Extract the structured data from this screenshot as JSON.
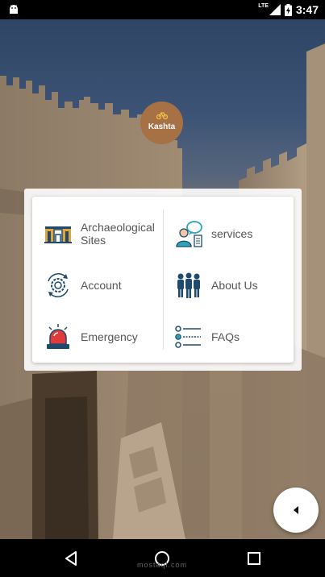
{
  "status_bar": {
    "network": "LTE",
    "time": "3:47",
    "icons": [
      "android-icon",
      "signal-icon",
      "battery-charging-icon"
    ]
  },
  "logo": {
    "text": "Kashta",
    "icon": "bicycle-icon"
  },
  "menu": {
    "items": [
      {
        "label": "Archaeological Sites",
        "icon": "archaeological-sites-icon"
      },
      {
        "label": "services",
        "icon": "customer-service-icon"
      },
      {
        "label": "Account",
        "icon": "account-gear-icon"
      },
      {
        "label": "About Us",
        "icon": "team-people-icon"
      },
      {
        "label": "Emergency",
        "icon": "siren-icon"
      },
      {
        "label": "FAQs",
        "icon": "faq-list-icon"
      }
    ]
  },
  "fab": {
    "icon": "back-arrow-icon"
  },
  "nav_bar": {
    "buttons": [
      "back-nav-icon",
      "home-nav-icon",
      "recents-nav-icon"
    ],
    "watermark": "mostaql.com"
  },
  "colors": {
    "logo_bg": "#a77146",
    "label_text": "#555555",
    "icon_blue": "#1e4a6e",
    "icon_gold": "#e0a43a",
    "icon_red": "#e03a3a",
    "icon_teal": "#2ba3b8"
  }
}
